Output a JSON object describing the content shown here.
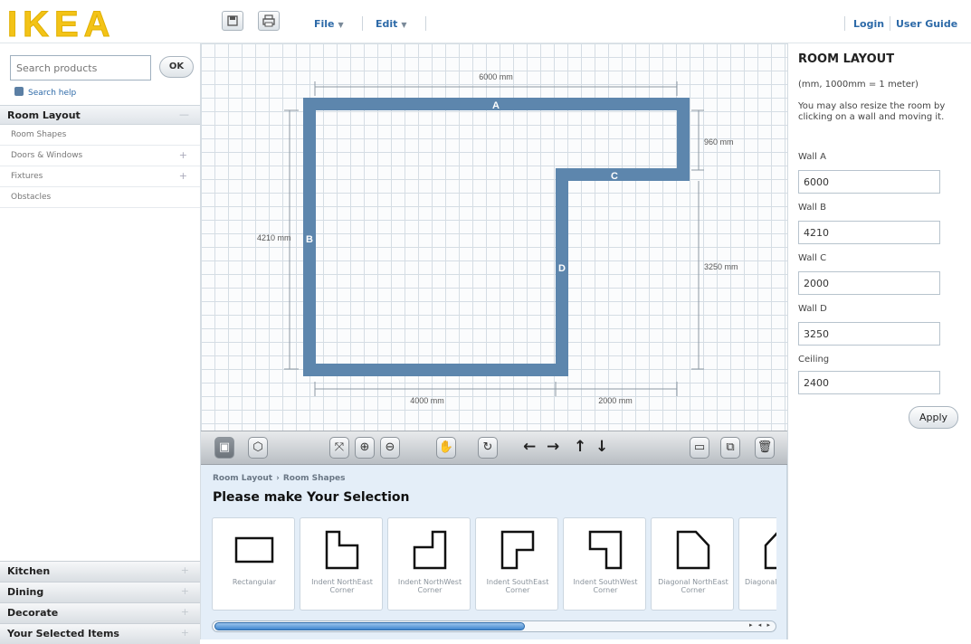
{
  "logo": {
    "text": "IKEA"
  },
  "header": {
    "menus": [
      "File",
      "Edit"
    ],
    "links": [
      "Login",
      "User Guide"
    ]
  },
  "sidebar": {
    "search_placeholder": "Search products",
    "ok_label": "OK",
    "search_help": "Search help",
    "room_layout_title": "Room Layout",
    "items": [
      {
        "label": "Room Shapes",
        "has_plus": false
      },
      {
        "label": "Doors & Windows",
        "has_plus": true
      },
      {
        "label": "Fixtures",
        "has_plus": true
      },
      {
        "label": "Obstacles",
        "has_plus": false
      }
    ],
    "bottom_sections": [
      "Kitchen",
      "Dining",
      "Decorate",
      "Your Selected Items"
    ]
  },
  "canvas": {
    "dimensions": {
      "top": "6000 mm",
      "right_small": "960 mm",
      "left": "4210 mm",
      "right": "3250 mm",
      "bottom_left": "4000 mm",
      "bottom_right": "2000 mm"
    },
    "walls": {
      "A": "A",
      "B": "B",
      "C": "C",
      "D": "D"
    }
  },
  "panel": {
    "breadcrumb": [
      "Room Layout",
      "Room Shapes"
    ],
    "title": "Please make Your Selection",
    "shapes": [
      {
        "label": "Rectangular"
      },
      {
        "label": "Indent NorthEast Corner"
      },
      {
        "label": "Indent NorthWest Corner"
      },
      {
        "label": "Indent SouthEast Corner"
      },
      {
        "label": "Indent SouthWest Corner"
      },
      {
        "label": "Diagonal NorthEast Corner"
      },
      {
        "label": "Diagonal NorthWest"
      }
    ],
    "scroll_fraction": 0.58
  },
  "room_layout": {
    "title": "ROOM LAYOUT",
    "units": "(mm, 1000mm = 1 meter)",
    "note": "You may also resize the room by clicking on a wall and moving it.",
    "walls": [
      {
        "label": "Wall A",
        "value": "6000"
      },
      {
        "label": "Wall B",
        "value": "4210"
      },
      {
        "label": "Wall C",
        "value": "2000"
      },
      {
        "label": "Wall D",
        "value": "3250"
      },
      {
        "label": "Ceiling",
        "value": "2400"
      }
    ],
    "apply_label": "Apply"
  },
  "colors": {
    "wall": "#5d86ad",
    "accent": "#2d6aa8",
    "logo_yellow": "#f3c317"
  }
}
